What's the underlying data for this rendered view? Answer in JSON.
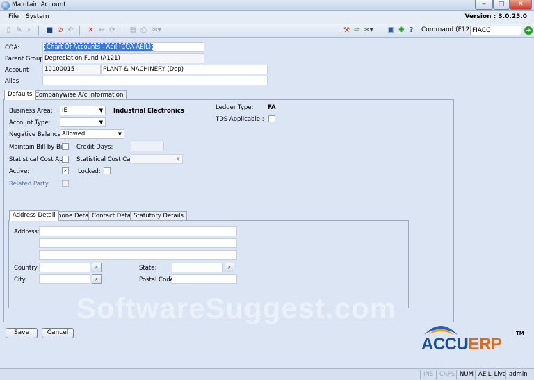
{
  "window": {
    "title": "Maintain Account",
    "min": "‒",
    "max": "□",
    "close": "✕"
  },
  "menu": {
    "items": [
      "File",
      "System"
    ],
    "version": "Version : 3.0.25.0"
  },
  "command": {
    "label": "Command (F12):",
    "value": "FIACC"
  },
  "header": {
    "coa_label": "COA:",
    "coa_value": "Chart Of Accounts - Aeil (COA-AEIL)",
    "parent_label": "Parent Group:",
    "parent_value": "Depreciation Fund (A121)",
    "account_label": "Account",
    "account_code": "10100015",
    "account_name": "PLANT & MACHINERY (Dep)",
    "alias_label": "Alias",
    "alias_value": ""
  },
  "tabs": [
    "Defaults",
    "Companywise A/c Information"
  ],
  "defaults": {
    "business_area_label": "Business Area:",
    "business_area_value": "IE",
    "business_area_name": "Industrial Electronics",
    "account_type_label": "Account Type:",
    "account_type_value": "",
    "negative_balance_label": "Negative Balance:",
    "negative_balance_value": "Allowed",
    "maintain_bill_label": "Maintain Bill by Bill:",
    "credit_days_label": "Credit Days:",
    "credit_days_value": "",
    "stat_cost_app_label": "Statistical Cost App:",
    "stat_cost_catg_label": "Statistical Cost Catg:",
    "stat_cost_catg_value": "",
    "active_label": "Active:",
    "active_checked": "✓",
    "locked_label": "Locked:",
    "related_party_label": "Related Party:",
    "ledger_type_label": "Ledger Type:",
    "ledger_type_value": "FA",
    "tds_label": "TDS Applicable :"
  },
  "address_tabs": [
    "Address Detail",
    "Phone Detail",
    "Contact Detail",
    "Statutory Details"
  ],
  "address": {
    "address_label": "Address:",
    "line1": "",
    "line2": "",
    "line3": "",
    "country_label": "Country:",
    "country_value": "",
    "state_label": "State:",
    "state_value": "",
    "city_label": "City:",
    "city_value": "",
    "postal_label": "Postal Code:",
    "postal_value": ""
  },
  "buttons": {
    "save": "Save",
    "cancel": "Cancel"
  },
  "watermark": "SoftwareSuggest.com",
  "logo": {
    "accu": "ACCU",
    "erp": "ERP",
    "tm": "TM",
    "accu_color": "#1f4e9c",
    "erp_color": "#e06a1a"
  },
  "status": {
    "ins": "INS",
    "caps": "CAPS",
    "num": "NUM",
    "db": "AEIL_Live",
    "user": "admin"
  },
  "colors": {
    "background": "#dbe5f4",
    "selection": "#3b78d8"
  }
}
